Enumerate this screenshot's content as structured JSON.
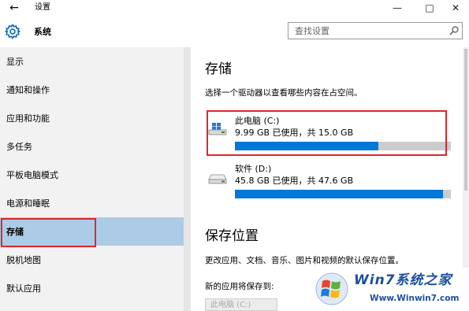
{
  "window": {
    "back_icon": "arrow-left-icon",
    "title": "设置",
    "controls": {
      "minimize": "—",
      "maximize": "□",
      "close": "✕"
    }
  },
  "header": {
    "icon": "gear-icon",
    "title": "系统",
    "search": {
      "placeholder": "查找设置",
      "icon": "search-icon"
    }
  },
  "sidebar": {
    "items": [
      {
        "label": "显示"
      },
      {
        "label": "通知和操作"
      },
      {
        "label": "应用和功能"
      },
      {
        "label": "多任务"
      },
      {
        "label": "平板电脑模式"
      },
      {
        "label": "电源和睡眠"
      },
      {
        "label": "存储"
      },
      {
        "label": "脱机地图"
      },
      {
        "label": "默认应用"
      }
    ],
    "selected": "存储",
    "selected_bg": "#abcbe7"
  },
  "main": {
    "storage": {
      "title": "存储",
      "description": "选择一个驱动器以查看哪些内容在占空间。",
      "drives": [
        {
          "name": "此电脑 (C:)",
          "usage": "9.99 GB 已使用，共 15.0 GB",
          "used_gb": 9.99,
          "total_gb": 15.0,
          "icon": "windows-drive-icon"
        },
        {
          "name": "软件 (D:)",
          "usage": "45.8 GB 已使用，共 47.6 GB",
          "used_gb": 45.8,
          "total_gb": 47.6,
          "icon": "drive-icon"
        }
      ]
    },
    "save_locations": {
      "title": "保存位置",
      "description": "更改应用、文档、音乐、图片和视频的默认保存位置。",
      "new_apps_label": "新的应用将保存到:",
      "new_apps_value": "此电脑 (C:)"
    }
  },
  "watermark": {
    "brand": "Win7系统之家",
    "url": "Www.Winwin7.com"
  },
  "colors": {
    "accent": "#0078d7",
    "highlight_red": "#e0262b",
    "bar_bg": "#cccccc",
    "sidebar_bg": "#f2f2f2"
  }
}
